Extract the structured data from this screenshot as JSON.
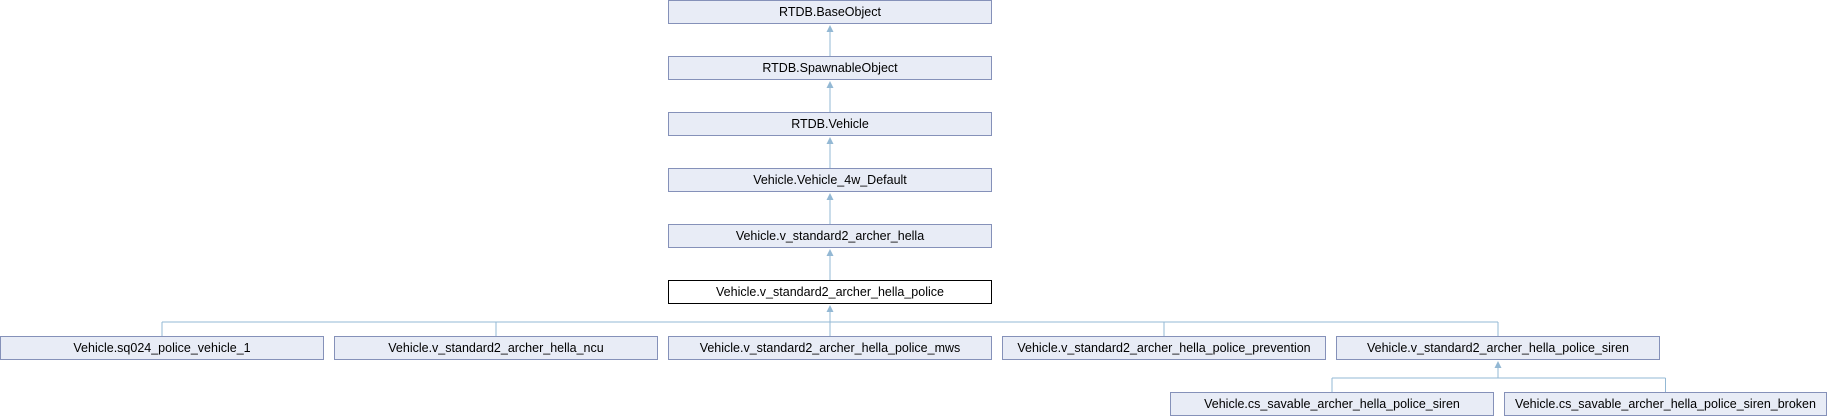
{
  "diagram": {
    "type": "class-inheritance",
    "nodes": {
      "base_object": "RTDB.BaseObject",
      "spawnable_object": "RTDB.SpawnableObject",
      "rtdb_vehicle": "RTDB.Vehicle",
      "vehicle_4w_default": "Vehicle.Vehicle_4w_Default",
      "archer_hella": "Vehicle.v_standard2_archer_hella",
      "archer_hella_police": "Vehicle.v_standard2_archer_hella_police",
      "sq024_police_vehicle_1": "Vehicle.sq024_police_vehicle_1",
      "archer_hella_ncu": "Vehicle.v_standard2_archer_hella_ncu",
      "archer_hella_police_mws": "Vehicle.v_standard2_archer_hella_police_mws",
      "archer_hella_police_prevention": "Vehicle.v_standard2_archer_hella_police_prevention",
      "archer_hella_police_siren": "Vehicle.v_standard2_archer_hella_police_siren",
      "cs_savable_archer_hella_police_siren": "Vehicle.cs_savable_archer_hella_police_siren",
      "cs_savable_archer_hella_police_siren_broken": "Vehicle.cs_savable_archer_hella_police_siren_broken"
    },
    "current_node": "archer_hella_police",
    "edges": [
      {
        "from": "spawnable_object",
        "to": "base_object"
      },
      {
        "from": "rtdb_vehicle",
        "to": "spawnable_object"
      },
      {
        "from": "vehicle_4w_default",
        "to": "rtdb_vehicle"
      },
      {
        "from": "archer_hella",
        "to": "vehicle_4w_default"
      },
      {
        "from": "archer_hella_police",
        "to": "archer_hella"
      },
      {
        "from": "sq024_police_vehicle_1",
        "to": "archer_hella_police"
      },
      {
        "from": "archer_hella_ncu",
        "to": "archer_hella_police"
      },
      {
        "from": "archer_hella_police_mws",
        "to": "archer_hella_police"
      },
      {
        "from": "archer_hella_police_prevention",
        "to": "archer_hella_police"
      },
      {
        "from": "archer_hella_police_siren",
        "to": "archer_hella_police"
      },
      {
        "from": "cs_savable_archer_hella_police_siren",
        "to": "archer_hella_police_siren"
      },
      {
        "from": "cs_savable_archer_hella_police_siren_broken",
        "to": "archer_hella_police_siren"
      }
    ],
    "colors": {
      "node_fill": "#e8ecf6",
      "node_border": "#8591b9",
      "current_fill": "#ffffff",
      "current_border": "#000000",
      "edge": "#93b8d4"
    }
  }
}
